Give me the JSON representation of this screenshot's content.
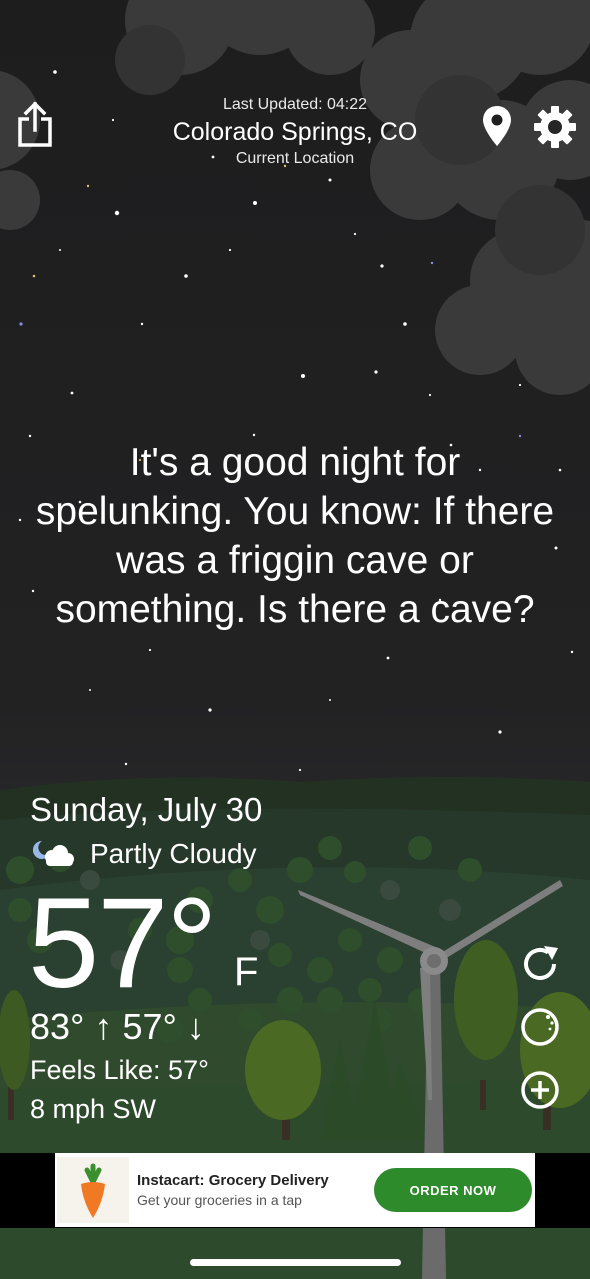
{
  "header": {
    "last_updated": "Last Updated: 04:22",
    "city": "Colorado Springs, CO",
    "location_label": "Current Location",
    "icons": [
      "share-icon",
      "location-pin-icon",
      "gear-icon"
    ]
  },
  "message": "It's a good night for spelunking. You know: If there was a friggin cave or something. Is there a cave?",
  "weather": {
    "date": "Sunday, July 30",
    "condition": "Partly Cloudy",
    "condition_icon": "partly-cloudy-night-icon",
    "temperature": "57°",
    "unit": "F",
    "hi_lo": "83° ↑ 57° ↓",
    "feels_like": "Feels Like: 57°",
    "wind": "8 mph SW"
  },
  "side_buttons": [
    "refresh-icon",
    "radar-icon",
    "plus-icon"
  ],
  "ad": {
    "title": "Instacart: Grocery Delivery",
    "subtitle": "Get your groceries in a tap",
    "cta": "ORDER NOW",
    "logo_icon": "carrot-icon"
  },
  "colors": {
    "sky": "#1d1d1e",
    "grass": "#2e4a2c",
    "cta_green": "#2e8b2b"
  }
}
